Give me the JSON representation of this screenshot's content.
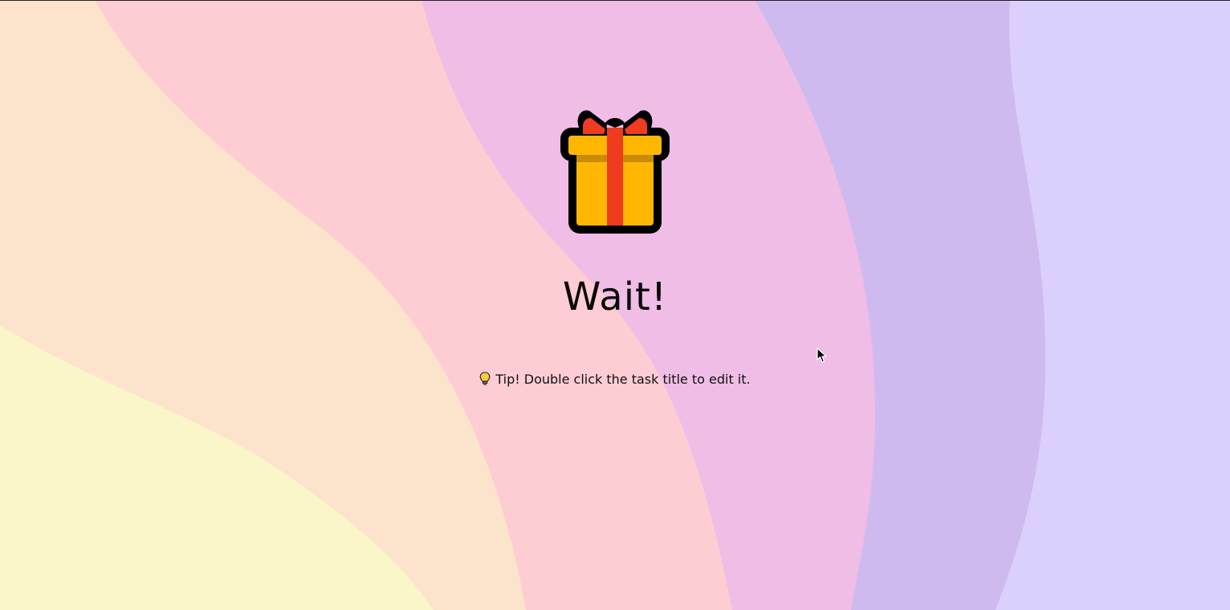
{
  "colors": {
    "band_1": "#fbf6ca",
    "band_2": "#fbe3cc",
    "band_3": "#fdcdd3",
    "band_4": "#efbde6",
    "band_5": "#cfbaf0",
    "band_6": "#dbd0fb",
    "gift_body": "#ffb703",
    "gift_ribbon": "#ef3b1f",
    "gift_outline": "#000000"
  },
  "icons": {
    "hero": "gift-icon",
    "tip": "lightbulb-icon",
    "pointer": "mouse-cursor-icon"
  },
  "main": {
    "title": "Wait!",
    "tip_text": "Tip! Double click the task title to edit it."
  }
}
